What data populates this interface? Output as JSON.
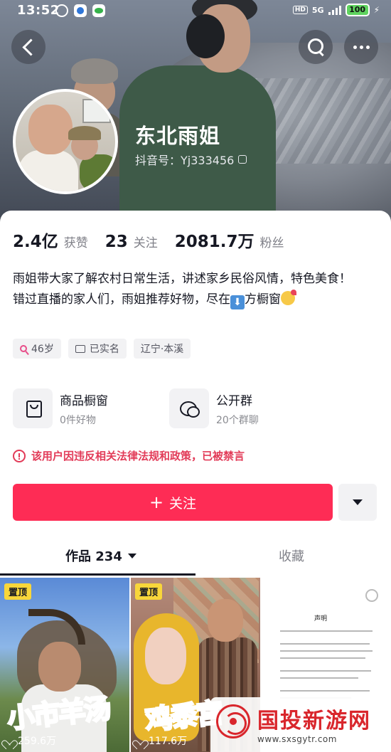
{
  "status_bar": {
    "time": "13:52",
    "hd": "HD",
    "network": "5G",
    "battery": "100"
  },
  "profile": {
    "nickname": "东北雨姐",
    "douyin_id": "抖音号：Yj333456"
  },
  "stats": [
    {
      "value": "2.4亿",
      "label": "获赞"
    },
    {
      "value": "23",
      "label": "关注"
    },
    {
      "value": "2081.7万",
      "label": "粉丝"
    }
  ],
  "bio": {
    "line1": "雨姐带大家了解农村日常生活，讲述家乡民俗风情，特色美食！",
    "line2_before": "错过直播的家人们，雨姐推荐好物，尽在",
    "line2_emoji": "⬇",
    "line2_after": "方橱窗"
  },
  "tags": {
    "age": "46岁",
    "verified": "已实名",
    "location": "辽宁·本溪"
  },
  "services": [
    {
      "title": "商品橱窗",
      "subtitle": "0件好物",
      "icon": "shopping-bag-icon"
    },
    {
      "title": "公开群",
      "subtitle": "20个群聊",
      "icon": "group-chat-icon"
    }
  ],
  "warning": "该用户因违反相关法律法规和政策，已被禁言",
  "follow": {
    "plus": "+",
    "label": "关注"
  },
  "tabs": {
    "works": "作品 234",
    "favorites": "收藏"
  },
  "videos": [
    {
      "pin": "置顶",
      "overlay": "小市羊汤",
      "views": "259.6万"
    },
    {
      "pin": "置顶",
      "overlay": "鸡黍宫",
      "views": "117.6万"
    },
    {
      "doc_title": "声明"
    }
  ],
  "watermark": {
    "name": "国投新游网",
    "url": "www.sxsgytr.com"
  },
  "colors": {
    "accent": "#fe2c55",
    "warning": "#e23b58",
    "pin_badge": "#f8d63a",
    "watermark": "#d9262c"
  }
}
